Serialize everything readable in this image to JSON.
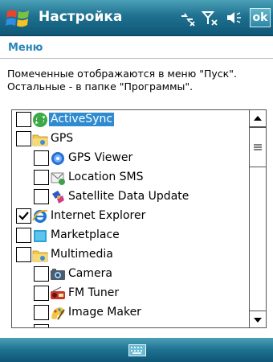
{
  "window": {
    "title": "Настройка",
    "ok_label": "ok"
  },
  "header": {
    "section": "Меню"
  },
  "description": "Помеченные отображаются в меню \"Пуск\". Остальные - в папке \"Программы\".",
  "items": [
    {
      "label": "ActiveSync",
      "checked": false,
      "indent": 0,
      "selected": true,
      "icon": "activesync-icon"
    },
    {
      "label": "GPS",
      "checked": false,
      "indent": 0,
      "selected": false,
      "icon": "folder-icon"
    },
    {
      "label": "GPS Viewer",
      "checked": false,
      "indent": 1,
      "selected": false,
      "icon": "gps-viewer-icon"
    },
    {
      "label": "Location SMS",
      "checked": false,
      "indent": 1,
      "selected": false,
      "icon": "location-sms-icon"
    },
    {
      "label": "Satellite Data Update",
      "checked": false,
      "indent": 1,
      "selected": false,
      "icon": "satellite-icon"
    },
    {
      "label": "Internet Explorer",
      "checked": true,
      "indent": 0,
      "selected": false,
      "icon": "internet-explorer-icon"
    },
    {
      "label": "Marketplace",
      "checked": false,
      "indent": 0,
      "selected": false,
      "icon": "marketplace-icon"
    },
    {
      "label": "Multimedia",
      "checked": false,
      "indent": 0,
      "selected": false,
      "icon": "folder-icon"
    },
    {
      "label": "Camera",
      "checked": false,
      "indent": 1,
      "selected": false,
      "icon": "camera-icon"
    },
    {
      "label": "FM Tuner",
      "checked": false,
      "indent": 1,
      "selected": false,
      "icon": "fm-tuner-icon"
    },
    {
      "label": "Image Maker",
      "checked": false,
      "indent": 1,
      "selected": false,
      "icon": "image-maker-icon"
    },
    {
      "label": "",
      "checked": false,
      "indent": 1,
      "selected": false,
      "icon": "partial-item-icon"
    }
  ],
  "colors": {
    "bar_top": "#4aa0b6",
    "bar_bottom": "#0f5676",
    "accent": "#2a85b9",
    "selection": "#2f8bd0"
  }
}
